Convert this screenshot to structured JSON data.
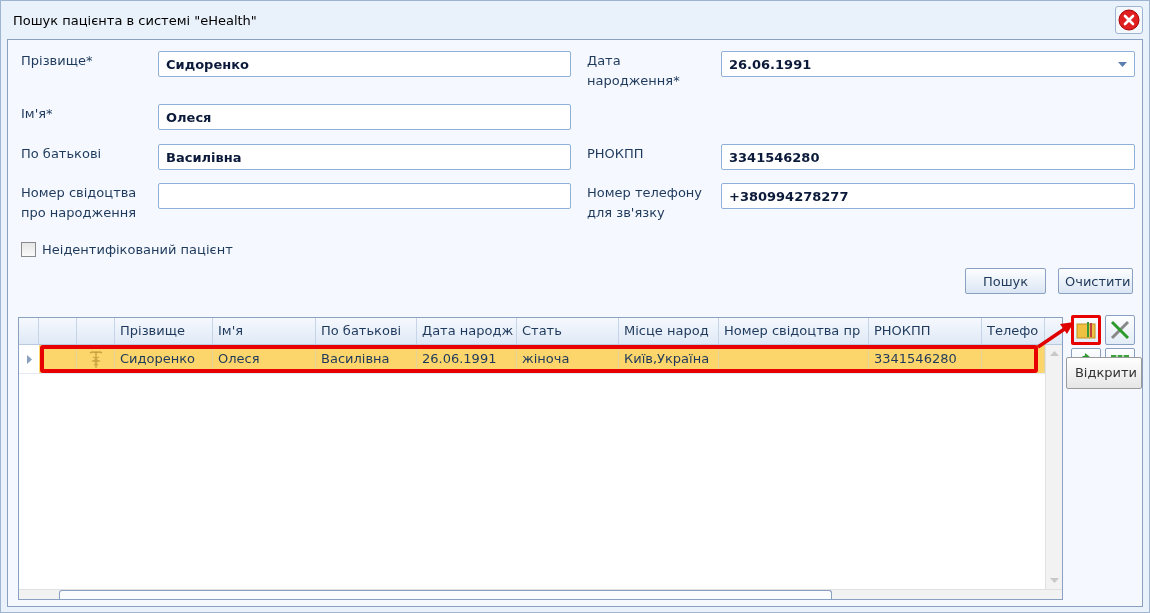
{
  "window": {
    "title": "Пошук пацієнта в системі \"eHealth\""
  },
  "form": {
    "rows": [
      {
        "left": {
          "label": "Прізвище*",
          "value": "Сидоренко",
          "kind": "text"
        },
        "right": {
          "label": "Дата народження*",
          "value": "26.06.1991",
          "kind": "date"
        }
      },
      {
        "left": {
          "label": "Ім'я*",
          "value": "Олеся",
          "kind": "text"
        }
      },
      {
        "left": {
          "label": "По батькові",
          "value": "Василівна",
          "kind": "text"
        },
        "right": {
          "label": "РНОКПП",
          "value": "3341546280",
          "kind": "text"
        }
      },
      {
        "left": {
          "label": "Номер свідоцтва про народження",
          "kind": "text"
        },
        "right": {
          "label": "Номер телефону для зв'язку",
          "value": "+380994278277",
          "kind": "text"
        }
      }
    ]
  },
  "unidentified_checkbox": {
    "label": "Неідентифікований пацієнт",
    "checked": false
  },
  "buttons": [
    "Пошук",
    "Очистити"
  ],
  "table": {
    "columns": [
      "Прізвище",
      "Ім'я",
      "По батькові",
      "Дата народж",
      "Стать",
      "Місце народ",
      "Номер свідоцтва пр",
      "РНОКПП",
      "Телефо"
    ],
    "rows": [
      {
        "selected": true,
        "highlighted": true,
        "cells": [
          "Сидоренко",
          "Олеся",
          "Василівна",
          "26.06.1991",
          "жіноча",
          "Київ,Україна",
          "",
          "3341546280",
          ""
        ]
      }
    ]
  },
  "toolbar": [
    {
      "kind": "open",
      "highlighted": true
    },
    {
      "kind": "tools",
      "highlighted": false
    },
    {
      "kind": "refresh",
      "highlighted": false
    },
    {
      "kind": "export",
      "highlighted": false
    }
  ],
  "tooltip": "Відкрити"
}
